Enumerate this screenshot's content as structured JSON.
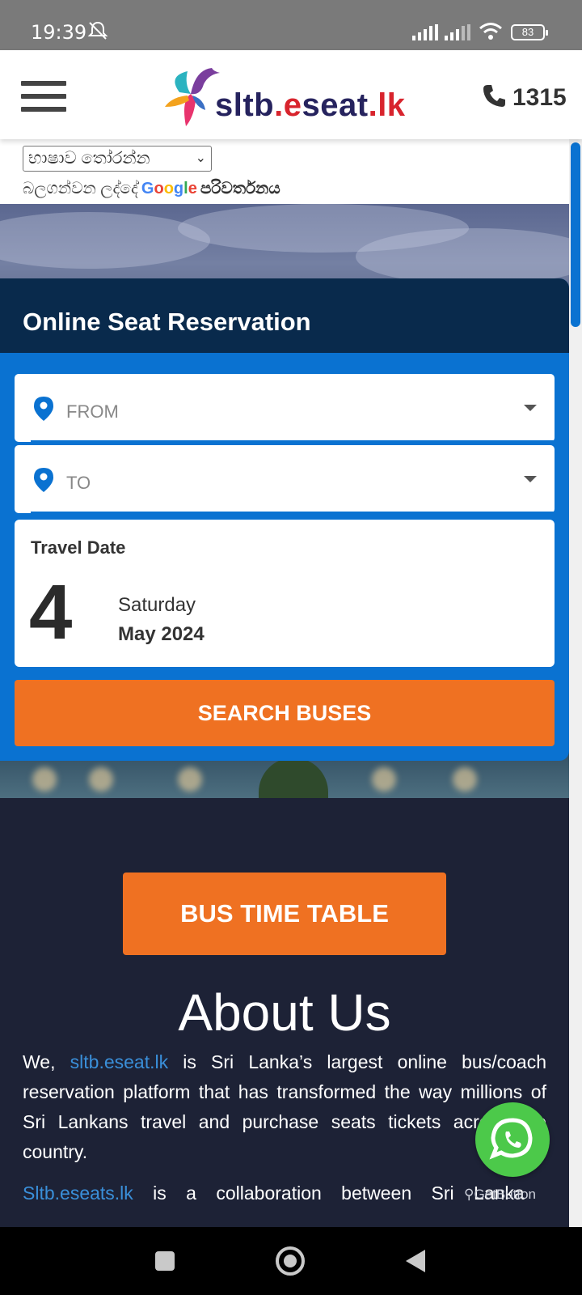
{
  "status_bar": {
    "time": "19:39",
    "battery": "83",
    "icons": [
      "bell-off-icon",
      "signal-icon",
      "signal-icon",
      "wifi-icon",
      "battery-icon"
    ]
  },
  "header": {
    "logo_text_a": "sltb",
    "logo_text_dot": ".",
    "logo_text_b": "e",
    "logo_text_c": "seat",
    "logo_text_dot2": ".",
    "logo_text_d": "lk",
    "phone_number": "1315",
    "menu_icon": "hamburger-menu-icon"
  },
  "language": {
    "select_value": "භාෂාව තෝරන්න",
    "powered_prefix": "බලගන්වන ලද්දේ",
    "google": "Google",
    "translate": "පරිවර්තනය"
  },
  "reservation": {
    "title": "Online Seat Reservation",
    "from_placeholder": "FROM",
    "to_placeholder": "TO",
    "date_label": "Travel Date",
    "date_day": "4",
    "date_weekday": "Saturday",
    "date_month_year": "May 2024",
    "search_label": "SEARCH BUSES"
  },
  "about": {
    "timetable_label": "BUS TIME TABLE",
    "title": "About Us",
    "p1_pre": "We, ",
    "p1_link": "sltb.eseat.lk",
    "p1_post": " is Sri Lanka’s largest online bus/coach reservation platform that has transformed the way millions of Sri Lankans travel and purchase seats tickets across the country.",
    "p2_link": "Sltb.eseats.lk",
    "p2_post": " is a collaboration between Sri Lanka"
  },
  "widgets": {
    "getbutton": "GetButton"
  },
  "colors": {
    "primary_blue": "#0a72d1",
    "navy": "#092a4c",
    "orange": "#ef7122",
    "dark_bg": "#1d2236",
    "whatsapp_green": "#4cc94a"
  }
}
